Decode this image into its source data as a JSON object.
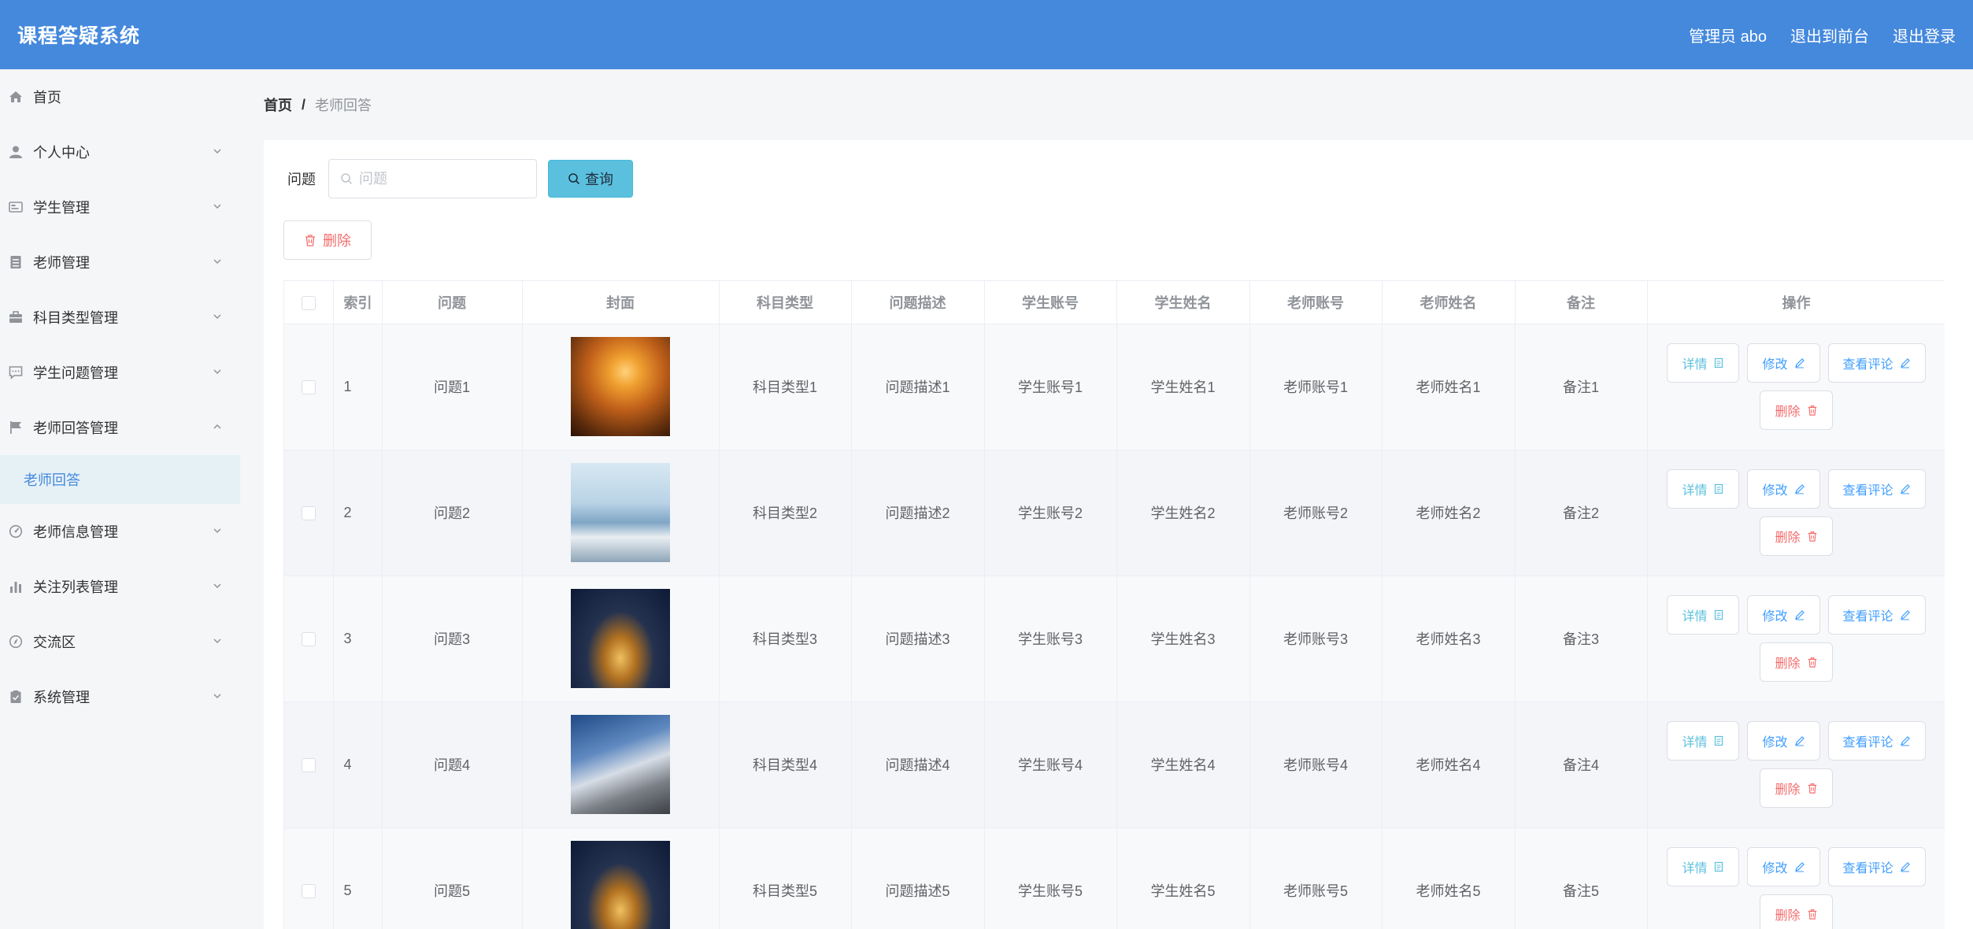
{
  "header": {
    "title": "课程答疑系统",
    "user_label": "管理员 abo",
    "front_link": "退出到前台",
    "logout_link": "退出登录",
    "bg_color": "#4589dd"
  },
  "sidebar": {
    "items": [
      {
        "label": "首页",
        "icon": "home-icon"
      },
      {
        "label": "个人中心",
        "icon": "user-icon"
      },
      {
        "label": "学生管理",
        "icon": "id-card-icon"
      },
      {
        "label": "老师管理",
        "icon": "notebook-icon"
      },
      {
        "label": "科目类型管理",
        "icon": "briefcase-icon"
      },
      {
        "label": "学生问题管理",
        "icon": "chat-icon"
      },
      {
        "label": "老师回答管理",
        "icon": "flag-icon"
      },
      {
        "label": "老师信息管理",
        "icon": "odometer-icon"
      },
      {
        "label": "关注列表管理",
        "icon": "bar-chart-icon"
      },
      {
        "label": "交流区",
        "icon": "compass-icon"
      },
      {
        "label": "系统管理",
        "icon": "clipboard-icon"
      }
    ],
    "active_sub": "老师回答"
  },
  "breadcrumb": {
    "home": "首页",
    "separator": "/",
    "current": "老师回答"
  },
  "search": {
    "label": "问题",
    "placeholder": "问题",
    "button": "查询"
  },
  "toolbar": {
    "batch_delete": "删除"
  },
  "table": {
    "columns": [
      "索引",
      "问题",
      "封面",
      "科目类型",
      "问题描述",
      "学生账号",
      "学生姓名",
      "老师账号",
      "老师姓名",
      "备注",
      "操作"
    ],
    "rows": [
      {
        "index": "1",
        "question": "问题1",
        "cover": "sunset-couple-photo",
        "subject": "科目类型1",
        "desc": "问题描述1",
        "stu_acc": "学生账号1",
        "stu_name": "学生姓名1",
        "tch_acc": "老师账号1",
        "tch_name": "老师姓名1",
        "note": "备注1"
      },
      {
        "index": "2",
        "question": "问题2",
        "cover": "wedding-couple-photo",
        "subject": "科目类型2",
        "desc": "问题描述2",
        "stu_acc": "学生账号2",
        "stu_name": "学生姓名2",
        "tch_acc": "老师账号2",
        "tch_name": "老师姓名2",
        "note": "备注2"
      },
      {
        "index": "3",
        "question": "问题3",
        "cover": "louvre-night-photo",
        "subject": "科目类型3",
        "desc": "问题描述3",
        "stu_acc": "学生账号3",
        "stu_name": "学生姓名3",
        "tch_acc": "老师账号3",
        "tch_name": "老师姓名3",
        "note": "备注3"
      },
      {
        "index": "4",
        "question": "问题4",
        "cover": "great-wall-bride-photo",
        "subject": "科目类型4",
        "desc": "问题描述4",
        "stu_acc": "学生账号4",
        "stu_name": "学生姓名4",
        "tch_acc": "老师账号4",
        "tch_name": "老师姓名4",
        "note": "备注4"
      },
      {
        "index": "5",
        "question": "问题5",
        "cover": "louvre-night-photo",
        "subject": "科目类型5",
        "desc": "问题描述5",
        "stu_acc": "学生账号5",
        "stu_name": "学生姓名5",
        "tch_acc": "老师账号5",
        "tch_name": "老师姓名5",
        "note": "备注5"
      }
    ],
    "actions": {
      "detail": "详情",
      "edit": "修改",
      "comments": "查看评论",
      "delete": "删除"
    }
  }
}
